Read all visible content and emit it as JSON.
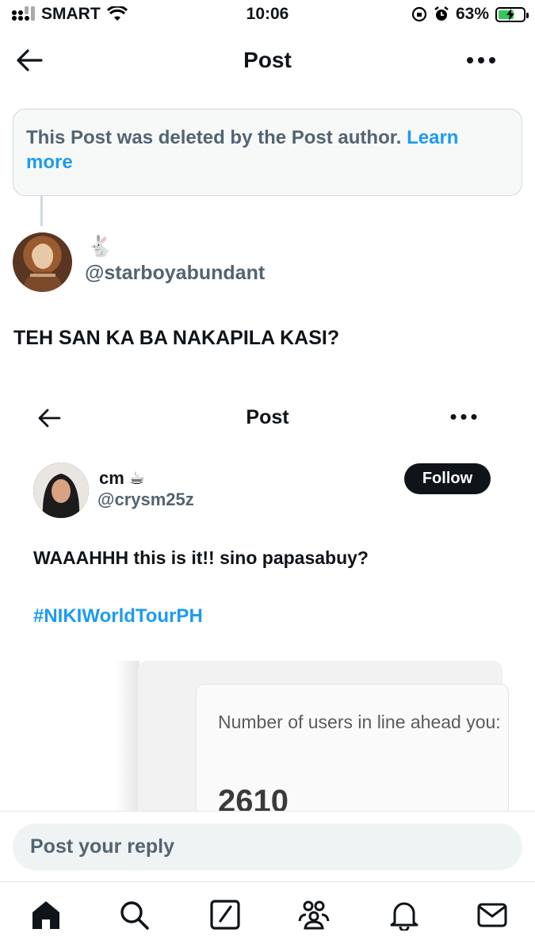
{
  "status_bar": {
    "carrier": "SMART",
    "time": "10:06",
    "battery_percent": "63%",
    "battery_level": 0.63,
    "charging": true
  },
  "header": {
    "title": "Post",
    "icons": [
      "back-arrow-icon",
      "more-icon"
    ]
  },
  "deleted_notice": {
    "text": "This Post was deleted by the Post author.",
    "link": "Learn more"
  },
  "post": {
    "display_name_emoji": "🐇",
    "handle": "@starboyabundant",
    "text": "TEH SAN KA BA NAKAPILA KASI?"
  },
  "embedded_screenshot": {
    "header_title": "Post",
    "display_name": "cm ☕",
    "handle": "@crysm25z",
    "follow_label": "Follow",
    "text": "WAAAHHH this is it!! sino papasabuy?",
    "hashtag": "#NIKIWorldTourPH",
    "queue_label": "Number of users in line ahead you:",
    "queue_number": "2610"
  },
  "reply": {
    "placeholder": "Post your reply"
  },
  "bottom_nav": {
    "items": [
      "home-icon",
      "search-icon",
      "compose-icon",
      "communities-icon",
      "notifications-icon",
      "messages-icon"
    ]
  },
  "colors": {
    "accent": "#1d9bf0",
    "text": "#0f1419",
    "muted": "#536471",
    "charging_green": "#34c759"
  }
}
